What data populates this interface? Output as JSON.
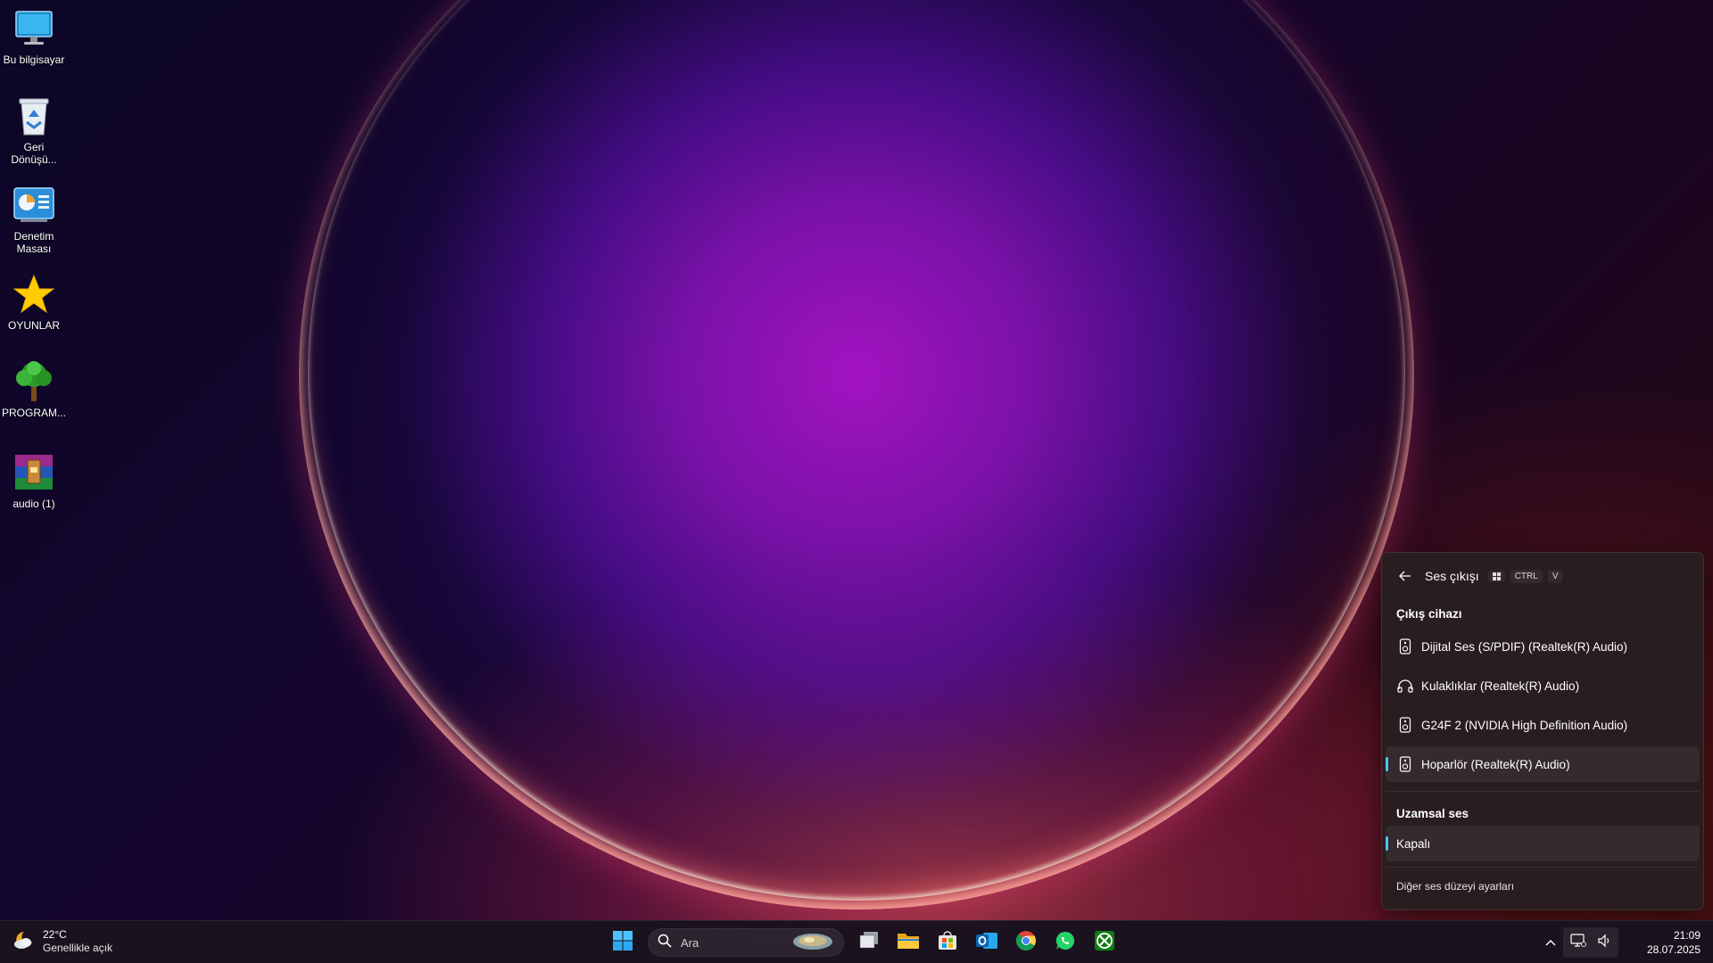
{
  "desktop": {
    "icons": [
      {
        "label": "Bu bilgisayar",
        "icon": "monitor-icon"
      },
      {
        "label": "Geri Dönüşü...",
        "icon": "recycle-bin-icon"
      },
      {
        "label": "Denetim Masası",
        "icon": "control-panel-icon"
      },
      {
        "label": "OYUNLAR",
        "icon": "star-folder-icon"
      },
      {
        "label": "PROGRAM...",
        "icon": "tree-folder-icon"
      },
      {
        "label": "audio (1)",
        "icon": "winrar-archive-icon"
      }
    ]
  },
  "taskbar": {
    "weather": {
      "temp": "22°C",
      "condition": "Genellikle açık"
    },
    "search_placeholder": "Ara",
    "apps": [
      "start",
      "search",
      "task-view",
      "file-explorer",
      "microsoft-store",
      "outlook",
      "chrome",
      "whatsapp",
      "xbox"
    ],
    "clock": {
      "time": "21:09",
      "date": "28.07.2025"
    }
  },
  "flyout": {
    "title": "Ses çıkışı",
    "shortcut": [
      "CTRL",
      "V"
    ],
    "output_section": "Çıkış cihazı",
    "devices": [
      {
        "name": "Dijital Ses (S/PDIF) (Realtek(R) Audio)",
        "icon": "speaker-icon",
        "selected": false
      },
      {
        "name": "Kulaklıklar (Realtek(R) Audio)",
        "icon": "headphones-icon",
        "selected": false
      },
      {
        "name": "G24F 2 (NVIDIA High Definition Audio)",
        "icon": "speaker-icon",
        "selected": false
      },
      {
        "name": "Hoparlör (Realtek(R) Audio)",
        "icon": "speaker-icon",
        "selected": true
      }
    ],
    "spatial_section": "Uzamsal ses",
    "spatial_value": "Kapalı",
    "footer_link": "Diğer ses düzeyi ayarları"
  },
  "colors": {
    "accent": "#4cc2ff",
    "flyout_bg": "#28201f",
    "taskbar_bg": "#1c141e"
  }
}
